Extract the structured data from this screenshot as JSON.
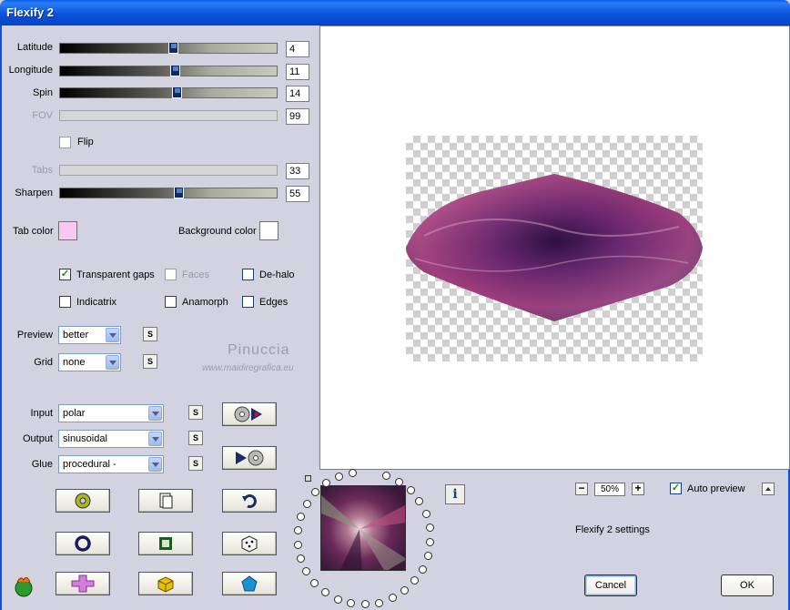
{
  "window": {
    "title": "Flexify 2"
  },
  "sliders": [
    {
      "label": "Latitude",
      "value": "4",
      "position": 0.52,
      "enabled": true
    },
    {
      "label": "Longitude",
      "value": "11",
      "position": 0.53,
      "enabled": true
    },
    {
      "label": "Spin",
      "value": "14",
      "position": 0.54,
      "enabled": true
    },
    {
      "label": "FOV",
      "value": "99",
      "enabled": false
    },
    {
      "label": "Tabs",
      "value": "33",
      "enabled": false
    },
    {
      "label": "Sharpen",
      "value": "55",
      "position": 0.55,
      "enabled": true
    }
  ],
  "flip": {
    "label": "Flip",
    "checked": false
  },
  "colors": {
    "tab_label": "Tab color",
    "tab_value": "#f8c8f0",
    "bg_label": "Background color",
    "bg_value": "#ffffff"
  },
  "checkboxes": [
    {
      "label": "Transparent gaps",
      "checked": true,
      "enabled": true
    },
    {
      "label": "Faces",
      "checked": false,
      "enabled": false
    },
    {
      "label": "De-halo",
      "checked": false,
      "enabled": true
    },
    {
      "label": "Indicatrix",
      "checked": false,
      "enabled": true
    },
    {
      "label": "Anamorph",
      "checked": false,
      "enabled": true
    },
    {
      "label": "Edges",
      "checked": false,
      "enabled": true
    }
  ],
  "preview_select": {
    "label": "Preview",
    "value": "better"
  },
  "grid_select": {
    "label": "Grid",
    "value": "none"
  },
  "input_select": {
    "label": "Input",
    "value": "polar"
  },
  "output_select": {
    "label": "Output",
    "value": "sinusoidal"
  },
  "glue_select": {
    "label": "Glue",
    "value": "procedural -"
  },
  "small_button_label": "S",
  "watermark": {
    "name": "Pinuccia",
    "url": "www.maidiregrafica.eu"
  },
  "zoom": {
    "value": "50%"
  },
  "auto_preview": {
    "label": "Auto preview",
    "checked": true
  },
  "settings_text": "Flexify 2 settings",
  "buttons": {
    "cancel": "Cancel",
    "ok": "OK"
  },
  "info_glyph": "i"
}
